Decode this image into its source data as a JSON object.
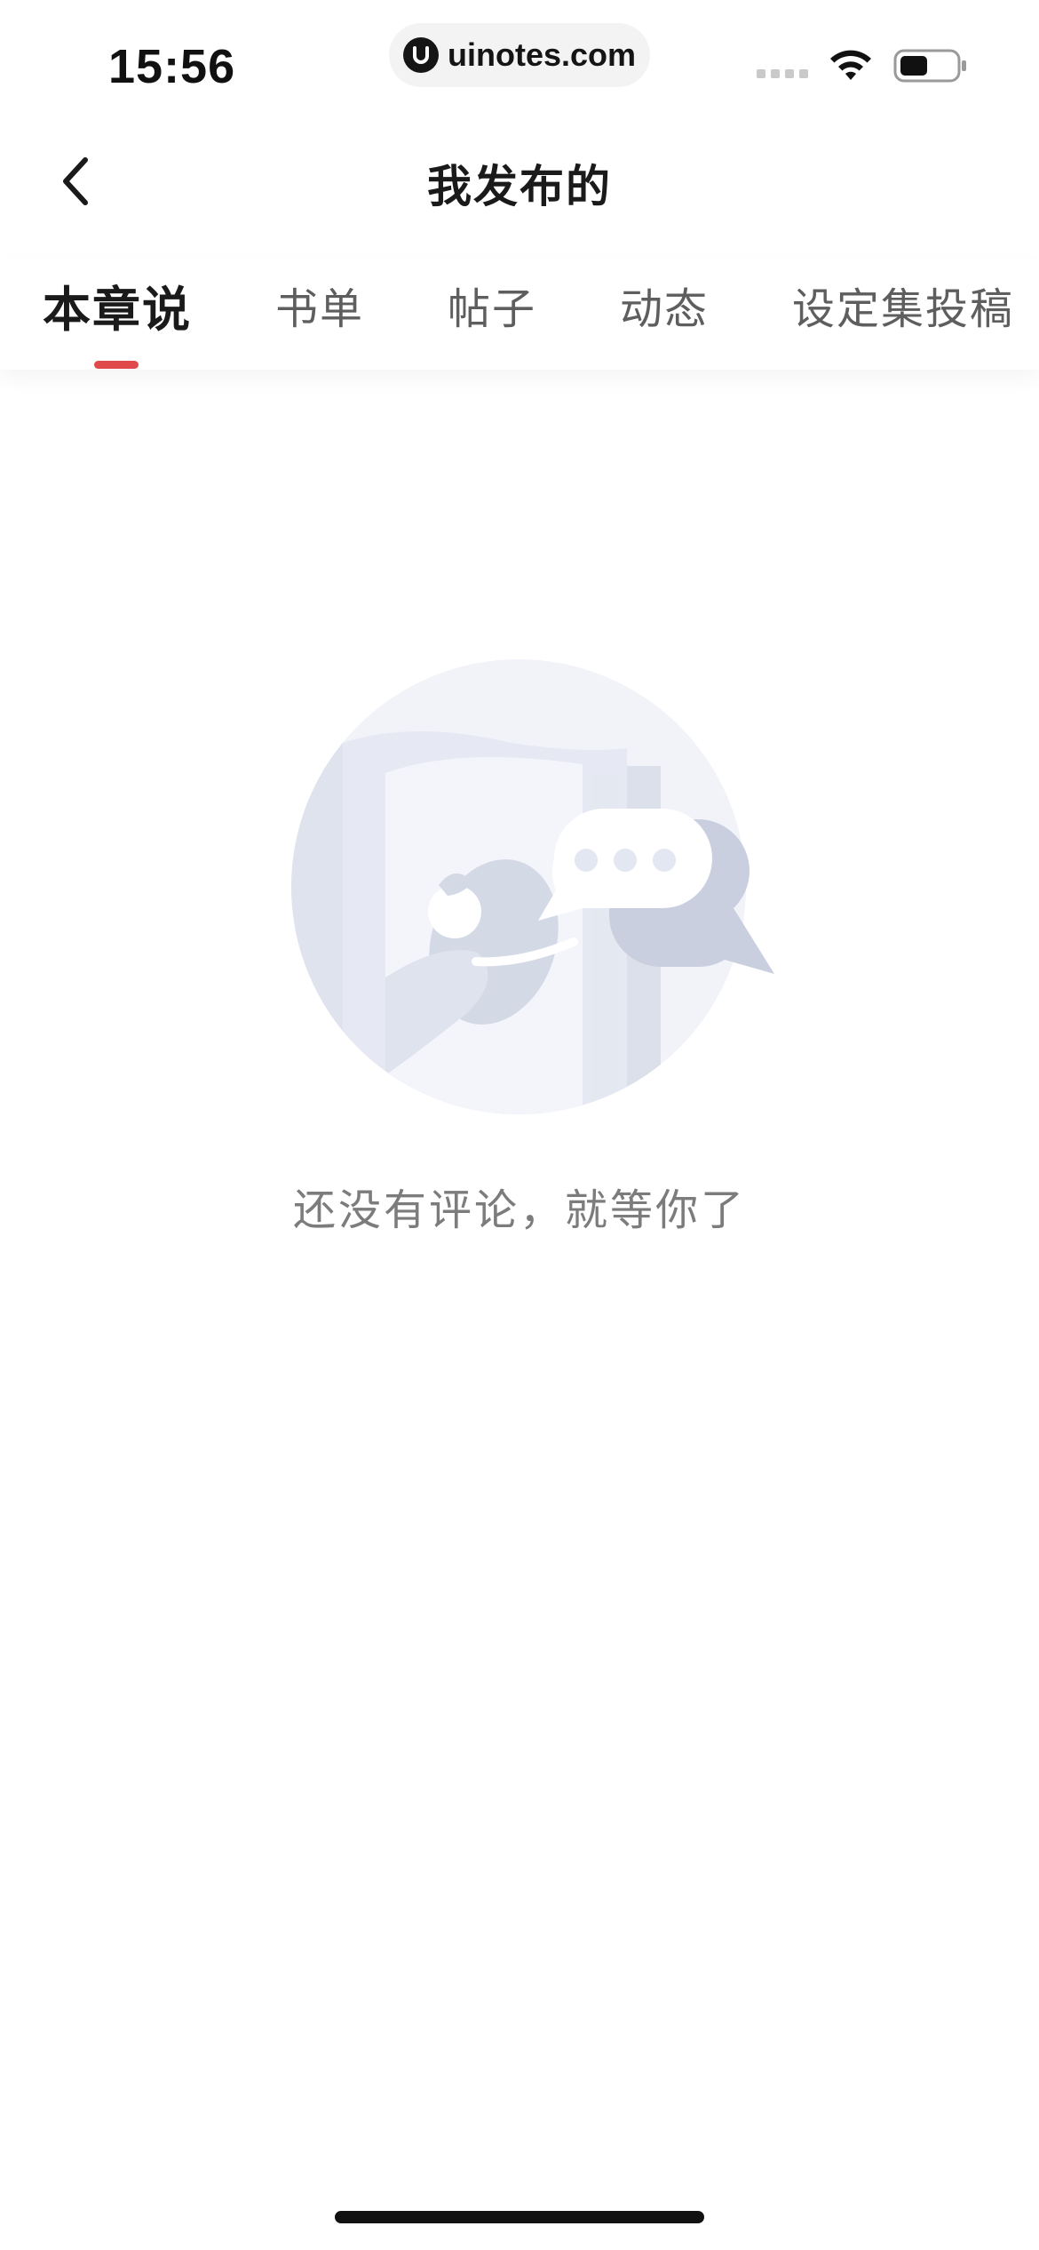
{
  "status_bar": {
    "time": "15:56",
    "url": "uinotes.com"
  },
  "nav": {
    "title": "我发布的",
    "back_icon": "chevron-left-icon"
  },
  "tabs": [
    {
      "label": "本章说",
      "active": true
    },
    {
      "label": "书单",
      "active": false
    },
    {
      "label": "帖子",
      "active": false
    },
    {
      "label": "动态",
      "active": false
    },
    {
      "label": "设定集投稿",
      "active": false
    }
  ],
  "empty_state": {
    "message": "还没有评论，就等你了",
    "illustration": "book-with-chat-bubbles-illustration"
  },
  "colors": {
    "accent": "#e04a4a",
    "illustration_light": "#eef1f8",
    "illustration_mid": "#dde2ee",
    "illustration_dark": "#c9cfde"
  }
}
